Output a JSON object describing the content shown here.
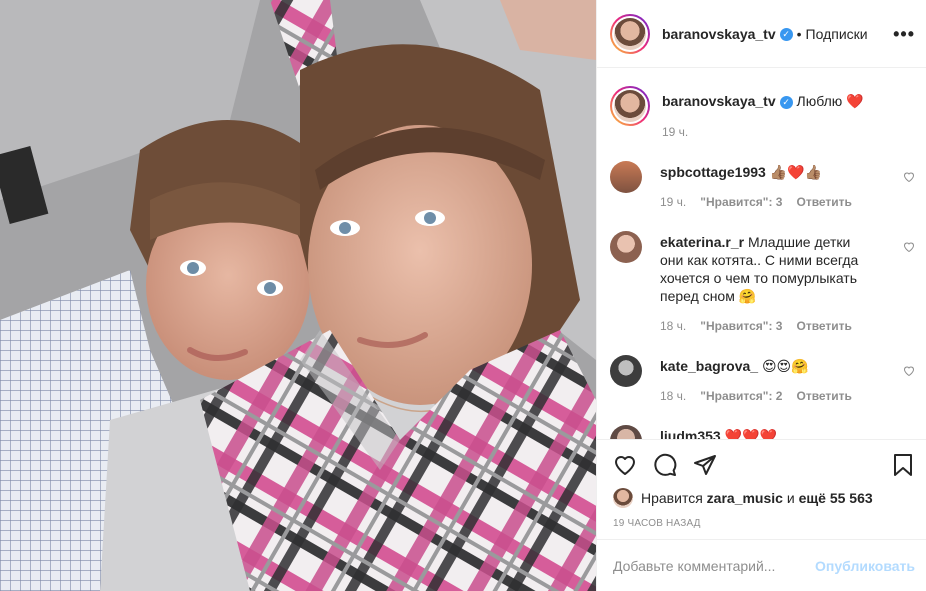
{
  "post": {
    "author": "baranovskaya_tv",
    "follow_label": "Подписки",
    "caption": "Люблю",
    "caption_emoji": "❤️",
    "caption_time": "19 ч.",
    "likes_prefix": "Нравится",
    "likes_user": "zara_music",
    "likes_middle": "и",
    "likes_rest": "ещё 55 563",
    "posted_ago": "19 ЧАСОВ НАЗАД"
  },
  "comments": [
    {
      "user": "spbcottage1993",
      "text": "👍🏽❤️👍🏽",
      "time": "19 ч.",
      "likes": "\"Нравится\": 3",
      "reply": "Ответить"
    },
    {
      "user": "ekaterina.r_r",
      "text": "Младшие детки они как котята.. С ними всегда хочется о чем то помурлыкать перед сном 🤗",
      "time": "18 ч.",
      "likes": "\"Нравится\": 3",
      "reply": "Ответить"
    },
    {
      "user": "kate_bagrova_",
      "text": "😍😍🤗",
      "time": "18 ч.",
      "likes": "\"Нравится\": 2",
      "reply": "Ответить"
    },
    {
      "user": "liudm353",
      "text": "❤️❤️❤️",
      "time": "",
      "likes": "",
      "reply": ""
    }
  ],
  "comment_box": {
    "placeholder": "Добавьте комментарий...",
    "publish": "Опубликовать"
  },
  "icons": {
    "verified": "verified-badge-icon",
    "more": "more-options-icon",
    "heart": "heart-icon",
    "comment": "comment-icon",
    "share": "share-icon",
    "save": "bookmark-icon"
  },
  "colors": {
    "accent_blue": "#3897f0",
    "publish_disabled": "#b3dbff",
    "muted_text": "#8e8e8e"
  }
}
